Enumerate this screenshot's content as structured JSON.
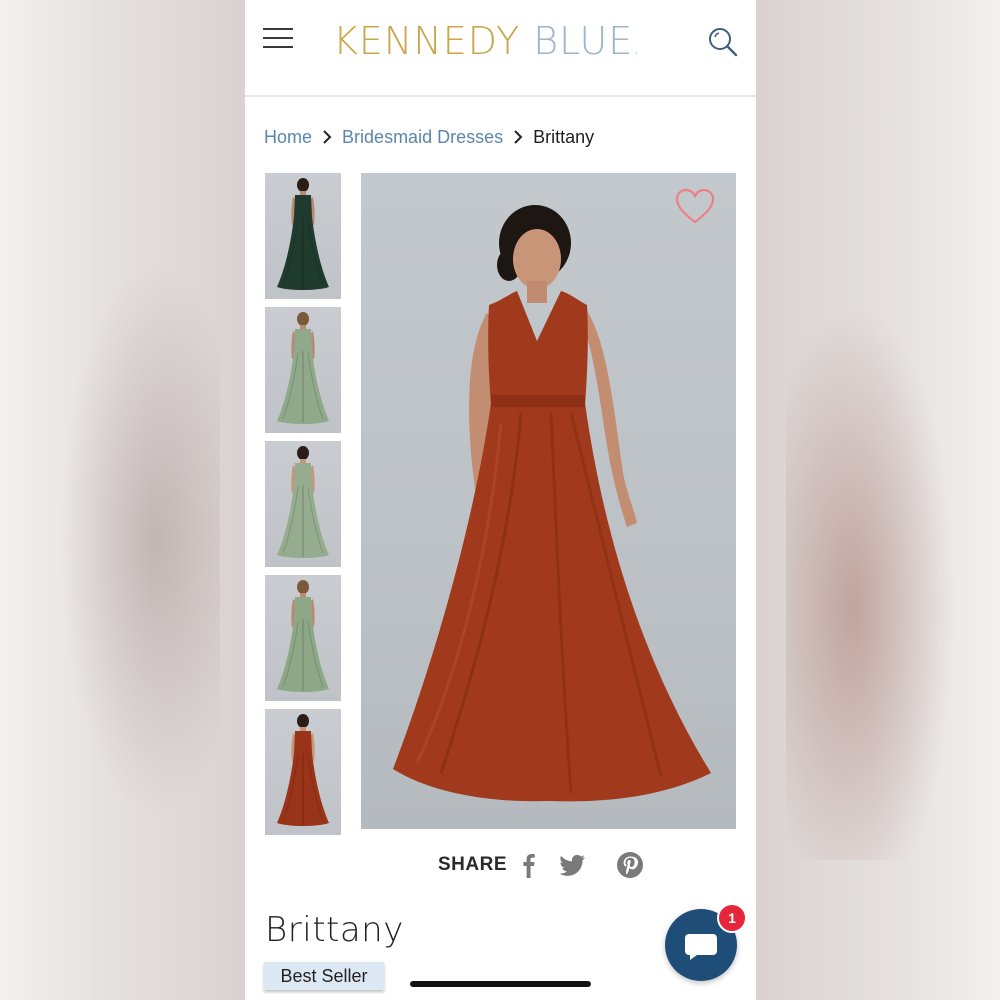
{
  "header": {
    "logo_part1": "KENNEDY",
    "logo_part2": "BLUE",
    "logo_dot": ".",
    "menu_icon": "hamburger-menu-icon",
    "search_icon": "search-icon"
  },
  "breadcrumb": {
    "items": [
      "Home",
      "Bridesmaid Dresses",
      "Brittany"
    ]
  },
  "gallery": {
    "thumbnails": [
      {
        "color": "#1f3b2e",
        "view": "back"
      },
      {
        "color": "#8fa98a",
        "view": "back"
      },
      {
        "color": "#95ad8e",
        "view": "front"
      },
      {
        "color": "#8ea887",
        "view": "back"
      },
      {
        "color": "#9a3418",
        "view": "front"
      }
    ],
    "main_color": "#a13a1c",
    "favorite_icon": "heart-icon"
  },
  "share": {
    "label": "SHARE",
    "icons": [
      "facebook-icon",
      "twitter-icon",
      "pinterest-icon"
    ]
  },
  "product": {
    "name": "Brittany",
    "badge": "Best Seller"
  },
  "chat": {
    "unread_count": "1",
    "icon": "chat-bubble-icon"
  },
  "colors": {
    "brand_gold": "#c9a64a",
    "brand_blue": "#9bb4cf",
    "link_blue": "#5b86ae",
    "chat_blue": "#1e4d77",
    "badge_red": "#e8263b"
  }
}
